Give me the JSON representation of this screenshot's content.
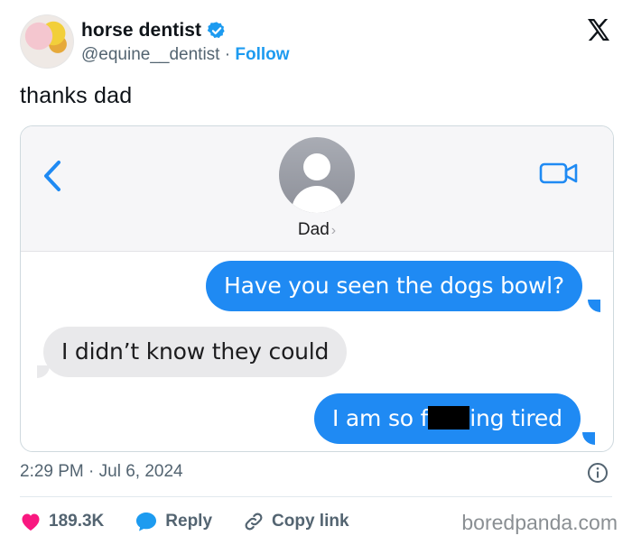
{
  "tweet": {
    "author_name": "horse dentist",
    "handle": "@equine__dentist",
    "separator": "·",
    "follow_label": "Follow",
    "text": "thanks dad",
    "timestamp": "2:29 PM · Jul 6, 2024",
    "likes": "189.3K",
    "reply_label": "Reply",
    "copy_link_label": "Copy link"
  },
  "screenshot": {
    "contact_name": "Dad",
    "contact_chevron": "›",
    "messages": [
      {
        "sender": "me",
        "text": "Have you seen the dogs bowl?"
      },
      {
        "sender": "dad",
        "text": "I didn’t know they could"
      },
      {
        "sender": "me",
        "text_before": "I am so f",
        "text_after": "ing tired"
      }
    ]
  },
  "watermark": "boredpanda.com",
  "icons": {
    "verified": "verified-badge-icon",
    "x_logo": "x-logo-icon",
    "back": "chevron-left-icon",
    "video": "video-camera-icon",
    "info": "info-icon",
    "like": "heart-icon",
    "reply": "speech-bubble-icon",
    "copy_link": "link-icon"
  },
  "colors": {
    "accent": "#1d9bf0",
    "like": "#f91880",
    "imessage_blue": "#1f8af3"
  }
}
